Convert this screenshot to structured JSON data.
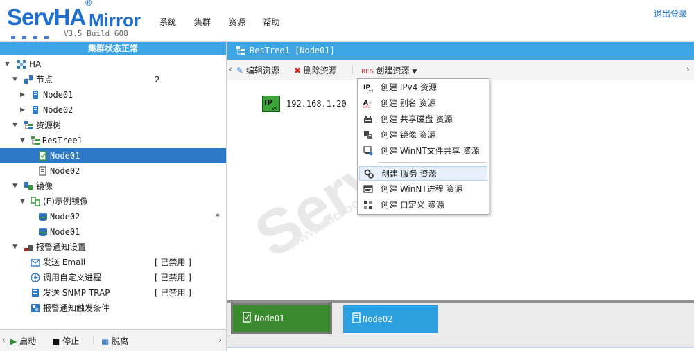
{
  "header": {
    "brand": "ServHA",
    "reg": "®",
    "product": "Mirror",
    "version": "V3.5 Build 608",
    "nav": [
      "系统",
      "集群",
      "资源",
      "帮助"
    ],
    "logout": "退出登录"
  },
  "left": {
    "status": "集群状态正常",
    "tree": [
      {
        "label": "HA",
        "icon": "cluster-icon",
        "arrow": "▼"
      },
      {
        "label": "节点",
        "icon": "nodes-icon",
        "arrow": "▼",
        "value": "2"
      },
      {
        "label": "Node01",
        "icon": "server-icon",
        "arrow": "▶"
      },
      {
        "label": "Node02",
        "icon": "server-icon",
        "arrow": "▶"
      },
      {
        "label": "资源树",
        "icon": "resource-tree-icon",
        "arrow": "▼"
      },
      {
        "label": "ResTree1",
        "icon": "restree-icon",
        "arrow": "▼"
      },
      {
        "label": "Node01",
        "icon": "restree-node-icon",
        "selected": true
      },
      {
        "label": "Node02",
        "icon": "restree-node-icon"
      },
      {
        "label": "镜像",
        "icon": "mirror-icon",
        "arrow": "▼"
      },
      {
        "label": "(E)示例镜像",
        "icon": "mirror-item-icon",
        "arrow": "▼"
      },
      {
        "label": "Node02",
        "icon": "disk-icon",
        "value": "*"
      },
      {
        "label": "Node01",
        "icon": "disk-icon"
      },
      {
        "label": "报警通知设置",
        "icon": "alarm-icon",
        "arrow": "▼"
      },
      {
        "label": "发送 Email",
        "icon": "email-icon",
        "value": "[ 已禁用 ]"
      },
      {
        "label": "调用自定义进程",
        "icon": "process-icon",
        "value": "[ 已禁用 ]"
      },
      {
        "label": "发送 SNMP TRAP",
        "icon": "snmp-icon",
        "value": "[ 已禁用 ]"
      },
      {
        "label": "报警通知触发条件",
        "icon": "trigger-icon"
      }
    ],
    "bottom": {
      "start": "启动",
      "stop": "停止",
      "detach": "脱离"
    }
  },
  "right": {
    "tab_title": "ResTree1 [Node01]",
    "toolbar": {
      "edit": "编辑资源",
      "delete": "删除资源",
      "create": "创建资源"
    },
    "resource_ip": "192.168.1.20",
    "menu": [
      {
        "label": "创建 IPv4 资源",
        "icon": "ipv4-icon"
      },
      {
        "label": "创建 别名 资源",
        "icon": "alias-icon"
      },
      {
        "label": "创建 共享磁盘 资源",
        "icon": "shared-disk-icon"
      },
      {
        "label": "创建 镜像 资源",
        "icon": "mirror-res-icon"
      },
      {
        "label": "创建 WinNT文件共享 资源",
        "icon": "file-share-icon"
      },
      {
        "label": "创建 服务 资源",
        "icon": "service-icon",
        "hover": true
      },
      {
        "label": "创建 WinNT进程 资源",
        "icon": "winnt-process-icon"
      },
      {
        "label": "创建 自定义 资源",
        "icon": "custom-icon"
      }
    ],
    "nodes": [
      {
        "label": "Node01",
        "color": "#3a8a2e"
      },
      {
        "label": "Node02",
        "color": "#2c9fdf"
      }
    ]
  }
}
